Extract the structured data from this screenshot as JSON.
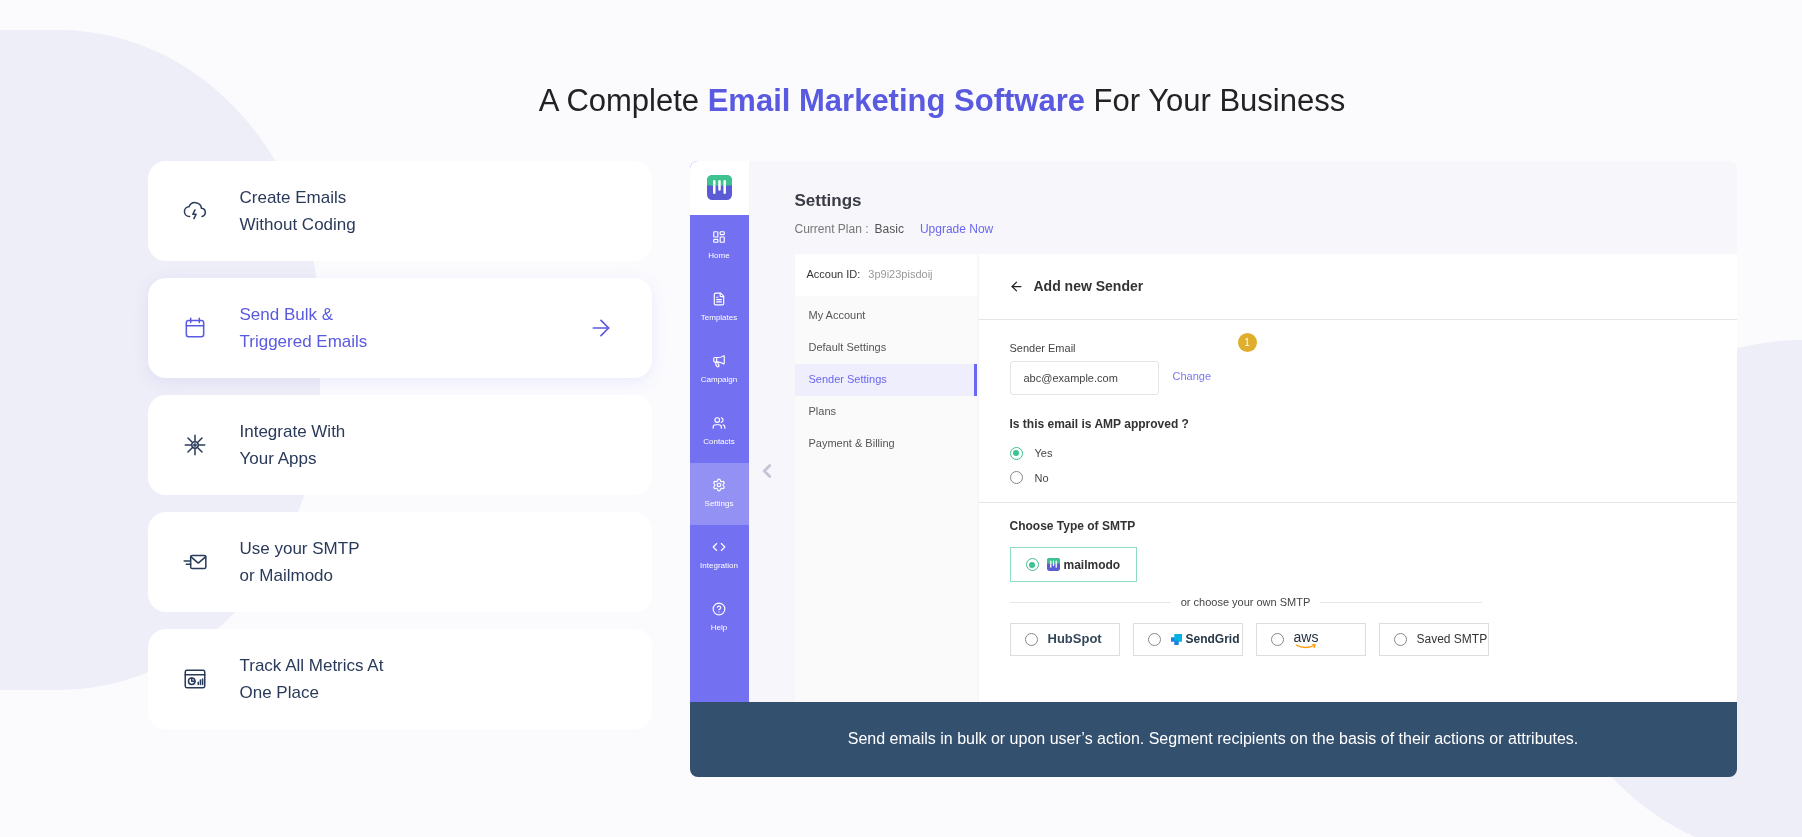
{
  "heading": {
    "before": "A Complete ",
    "highlight": "Email Marketing Software",
    "after": " For Your Business"
  },
  "features": [
    {
      "kind": "cloud",
      "lines": [
        "Create Emails",
        "Without Coding"
      ],
      "selected": false
    },
    {
      "kind": "calendar",
      "lines": [
        "Send Bulk &",
        "Triggered Emails"
      ],
      "selected": true
    },
    {
      "kind": "integrate",
      "lines": [
        "Integrate With",
        "Your Apps"
      ],
      "selected": false
    },
    {
      "kind": "mail",
      "lines": [
        "Use your SMTP",
        "or Mailmodo"
      ],
      "selected": false
    },
    {
      "kind": "metrics",
      "lines": [
        "Track All Metrics At",
        "One Place"
      ],
      "selected": false
    }
  ],
  "app": {
    "sidebar": [
      {
        "kind": "home",
        "label": "Home",
        "selected": false
      },
      {
        "kind": "templates",
        "label": "Templates",
        "selected": false
      },
      {
        "kind": "campaign",
        "label": "Campaign",
        "selected": false
      },
      {
        "kind": "contacts",
        "label": "Contacts",
        "selected": false
      },
      {
        "kind": "settings",
        "label": "Settings",
        "selected": true
      },
      {
        "kind": "integration",
        "label": "Integration",
        "selected": false
      },
      {
        "kind": "help",
        "label": "Help",
        "selected": false
      }
    ],
    "title": "Settings",
    "plan_label": "Current Plan :",
    "plan": "Basic",
    "upgrade": "Upgrade Now",
    "account_label": "Accoun ID:",
    "account_id": "3p9i23pisdoij",
    "menu": [
      {
        "label": "My Account",
        "selected": false
      },
      {
        "label": "Default Settings",
        "selected": false
      },
      {
        "label": "Sender Settings",
        "selected": true
      },
      {
        "label": "Plans",
        "selected": false
      },
      {
        "label": "Payment & Billing",
        "selected": false
      }
    ],
    "form_title": "Add new Sender",
    "sender_label": "Sender Email",
    "sender_value": "abc@example.com",
    "change": "Change",
    "badge": "1",
    "amp_question": "Is this email is AMP approved ?",
    "amp_options": [
      {
        "label": "Yes",
        "selected": true
      },
      {
        "label": "No",
        "selected": false
      }
    ],
    "smtp_title": "Choose Type of SMTP",
    "default_smtp": {
      "kind": "mailmodo",
      "label": "mailmodo",
      "selected": true
    },
    "divider": "or choose your own SMTP",
    "providers": [
      {
        "kind": "hubspot",
        "label": "HubSpot",
        "selected": false
      },
      {
        "kind": "sendgrid",
        "label": "SendGrid",
        "selected": false
      },
      {
        "kind": "aws",
        "label": "aws",
        "selected": false
      },
      {
        "kind": "saved",
        "label": "Saved SMTP",
        "selected": false
      }
    ]
  },
  "caption": "Send emails in bulk or upon user’s action. Segment recipients on the basis of their actions or attributes."
}
